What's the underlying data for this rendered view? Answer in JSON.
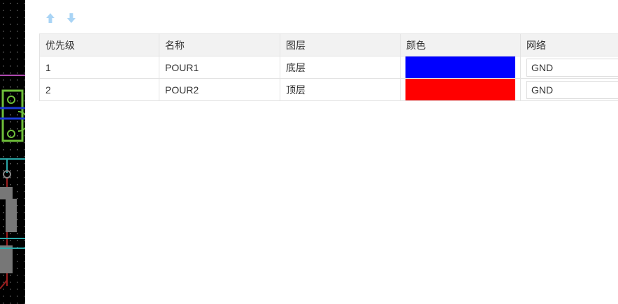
{
  "toolbar": {
    "move_up_icon": "arrow-up-icon",
    "move_down_icon": "arrow-down-icon"
  },
  "table": {
    "headers": [
      "优先级",
      "名称",
      "图层",
      "颜色",
      "网络"
    ],
    "rows": [
      {
        "priority": "1",
        "name": "POUR1",
        "layer": "底层",
        "color": "#0000ff",
        "net": "GND"
      },
      {
        "priority": "2",
        "name": "POUR2",
        "layer": "顶层",
        "color": "#ff0000",
        "net": "GND"
      }
    ]
  },
  "colors": {
    "header_bg": "#f2f2f2",
    "border": "#e3e3e3",
    "icon": "#a9d4f5",
    "canvas_bg": "#000000"
  }
}
